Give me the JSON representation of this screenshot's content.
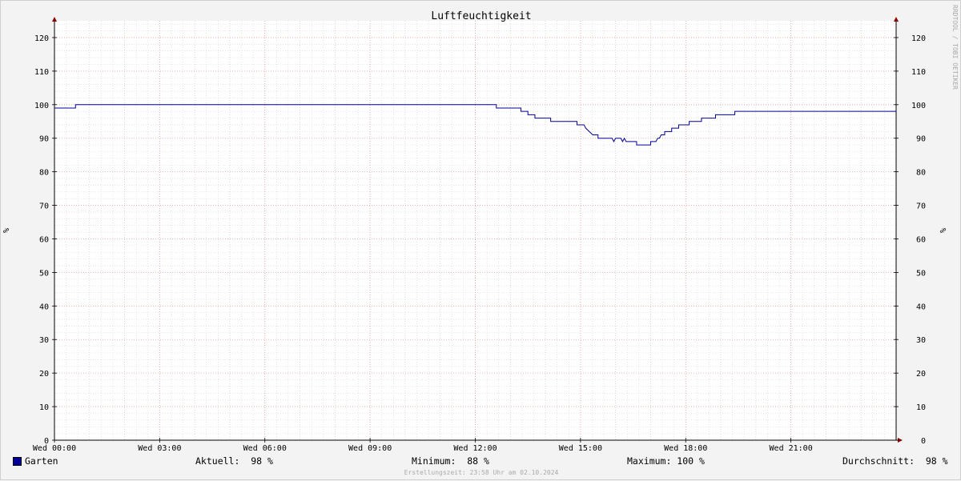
{
  "chart_data": {
    "type": "line",
    "title": "Luftfeuchtigkeit",
    "ylabel": "%",
    "ylabel_right": "%",
    "ylim": [
      0,
      125
    ],
    "xlim_hours": [
      0,
      24
    ],
    "y_ticks": [
      0,
      10,
      20,
      30,
      40,
      50,
      60,
      70,
      80,
      90,
      100,
      110,
      120
    ],
    "x_tick_labels": [
      {
        "hour": 0,
        "label": "Wed 00:00"
      },
      {
        "hour": 3,
        "label": "Wed 03:00"
      },
      {
        "hour": 6,
        "label": "Wed 06:00"
      },
      {
        "hour": 9,
        "label": "Wed 09:00"
      },
      {
        "hour": 12,
        "label": "Wed 12:00"
      },
      {
        "hour": 15,
        "label": "Wed 15:00"
      },
      {
        "hour": 18,
        "label": "Wed 18:00"
      },
      {
        "hour": 21,
        "label": "Wed 21:00"
      }
    ],
    "grid": true,
    "legend_position": "bottom-left",
    "series": [
      {
        "name": "Garten",
        "color": "#000099",
        "points": [
          [
            0.0,
            99
          ],
          [
            0.6,
            99
          ],
          [
            0.6,
            100
          ],
          [
            12.6,
            100
          ],
          [
            12.6,
            99
          ],
          [
            13.3,
            99
          ],
          [
            13.3,
            98
          ],
          [
            13.5,
            98
          ],
          [
            13.5,
            97
          ],
          [
            13.7,
            97
          ],
          [
            13.7,
            96
          ],
          [
            14.15,
            96
          ],
          [
            14.15,
            95
          ],
          [
            14.9,
            95
          ],
          [
            14.9,
            94
          ],
          [
            15.1,
            94
          ],
          [
            15.15,
            93
          ],
          [
            15.25,
            92
          ],
          [
            15.35,
            91
          ],
          [
            15.5,
            91
          ],
          [
            15.5,
            90
          ],
          [
            15.9,
            90
          ],
          [
            15.95,
            89
          ],
          [
            16.0,
            90
          ],
          [
            16.15,
            90
          ],
          [
            16.2,
            89
          ],
          [
            16.25,
            90
          ],
          [
            16.3,
            89
          ],
          [
            16.6,
            89
          ],
          [
            16.6,
            88
          ],
          [
            17.0,
            88
          ],
          [
            17.0,
            89
          ],
          [
            17.15,
            89
          ],
          [
            17.2,
            90
          ],
          [
            17.25,
            90
          ],
          [
            17.3,
            91
          ],
          [
            17.4,
            91
          ],
          [
            17.4,
            92
          ],
          [
            17.6,
            92
          ],
          [
            17.6,
            93
          ],
          [
            17.8,
            93
          ],
          [
            17.8,
            94
          ],
          [
            18.1,
            94
          ],
          [
            18.1,
            95
          ],
          [
            18.45,
            95
          ],
          [
            18.45,
            96
          ],
          [
            18.7,
            96
          ],
          [
            18.85,
            96
          ],
          [
            18.85,
            97
          ],
          [
            19.4,
            97
          ],
          [
            19.4,
            98
          ],
          [
            24.0,
            98
          ]
        ]
      }
    ]
  },
  "legend": {
    "series_name": "Garten",
    "current": "Aktuell:  98 %",
    "minimum": "Minimum:  88 %",
    "maximum": "Maximum: 100 %",
    "average": "Durchschnitt:  98 %"
  },
  "footer": "Erstellungszeit: 23:58 Uhr am 02.10.2024",
  "watermark": "RRDTOOL / TOBI OETIKER",
  "colors": {
    "series": "#000099",
    "major_grid": "#e8a0a0",
    "minor_grid": "#d4d4d4",
    "axis": "#000000",
    "arrow": "#8b0000"
  }
}
